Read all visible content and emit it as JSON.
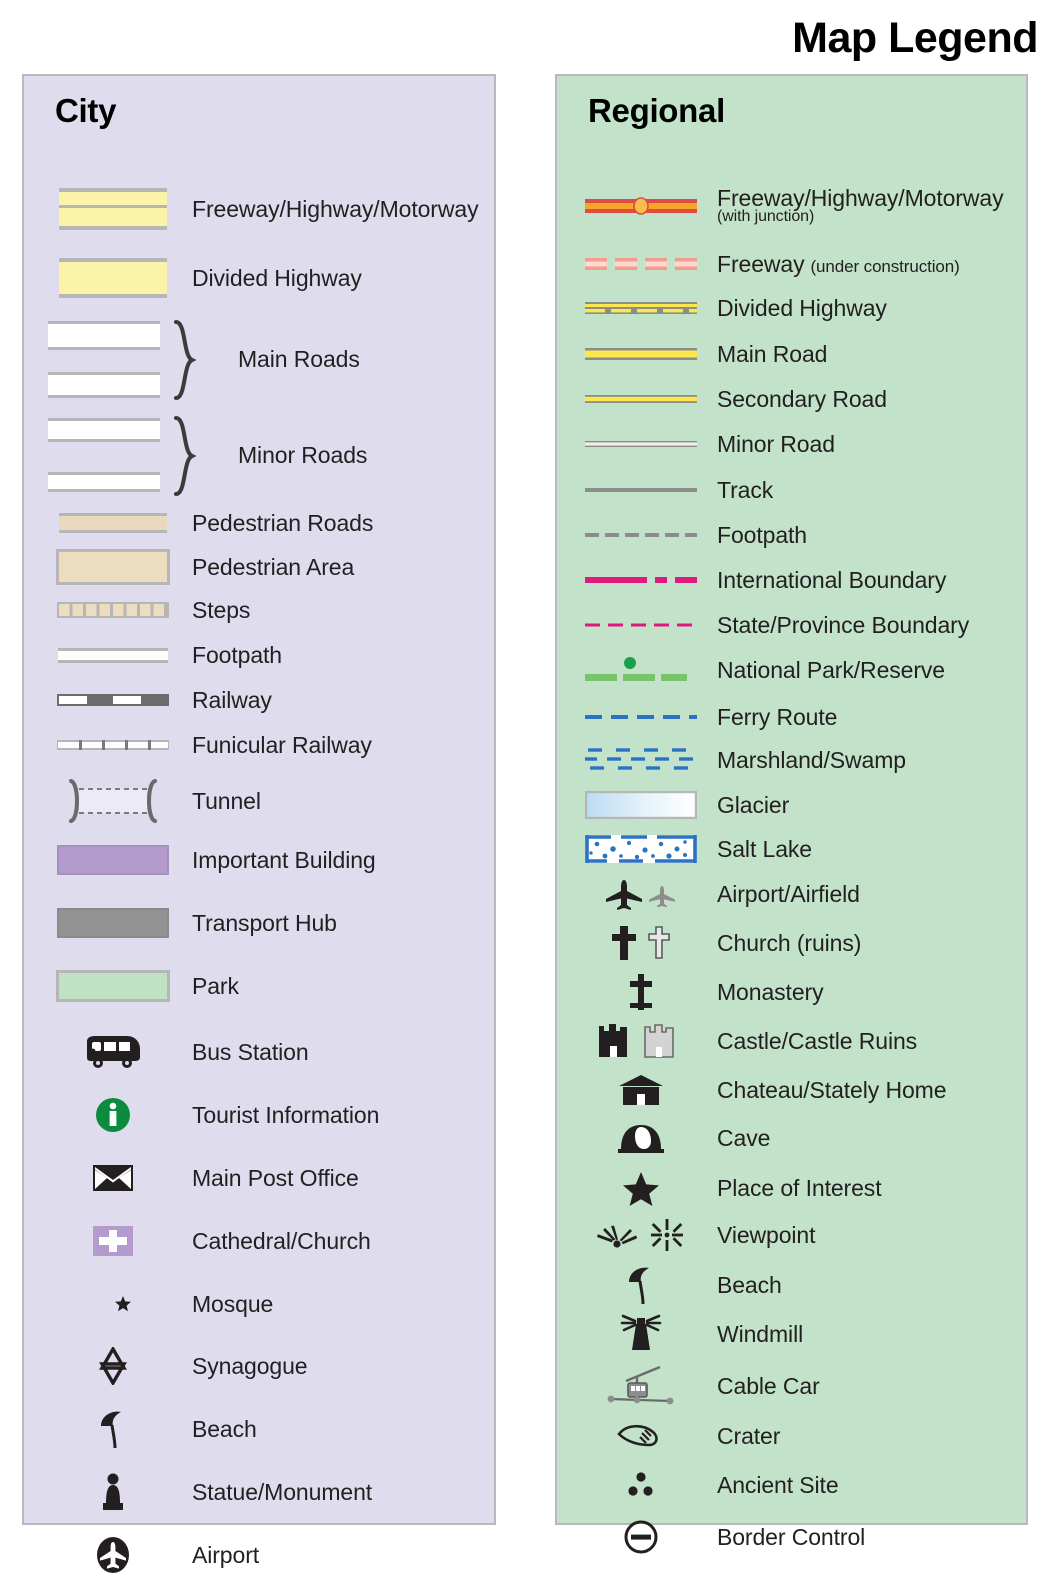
{
  "header": {
    "title": "Map Legend"
  },
  "city": {
    "heading": "City",
    "items": [
      {
        "label": "Freeway/Highway/Motorway",
        "symbol": "freeway-swatch"
      },
      {
        "label": "Divided Highway",
        "symbol": "divided-highway-swatch"
      },
      {
        "label": "Main Roads",
        "symbol": "main-roads-swatch-pair"
      },
      {
        "label": "Minor Roads",
        "symbol": "minor-roads-swatch-pair"
      },
      {
        "label": "Pedestrian Roads",
        "symbol": "pedestrian-road-swatch"
      },
      {
        "label": "Pedestrian Area",
        "symbol": "pedestrian-area-swatch"
      },
      {
        "label": "Steps",
        "symbol": "steps-swatch"
      },
      {
        "label": "Footpath",
        "symbol": "footpath-line"
      },
      {
        "label": "Railway",
        "symbol": "railway-line"
      },
      {
        "label": "Funicular Railway",
        "symbol": "funicular-railway-line"
      },
      {
        "label": "Tunnel",
        "symbol": "tunnel-symbol"
      },
      {
        "label": "Important Building",
        "symbol": "important-building-swatch"
      },
      {
        "label": "Transport Hub",
        "symbol": "transport-hub-swatch"
      },
      {
        "label": "Park",
        "symbol": "park-swatch"
      },
      {
        "label": "Bus Station",
        "symbol": "bus-icon"
      },
      {
        "label": "Tourist Information",
        "symbol": "information-icon"
      },
      {
        "label": "Main Post Office",
        "symbol": "envelope-icon"
      },
      {
        "label": "Cathedral/Church",
        "symbol": "cross-square-icon"
      },
      {
        "label": "Mosque",
        "symbol": "crescent-star-icon"
      },
      {
        "label": "Synagogue",
        "symbol": "star-of-david-icon"
      },
      {
        "label": "Beach",
        "symbol": "parasol-icon"
      },
      {
        "label": "Statue/Monument",
        "symbol": "statue-icon"
      },
      {
        "label": "Airport",
        "symbol": "airport-circle-icon"
      }
    ]
  },
  "regional": {
    "heading": "Regional",
    "items": [
      {
        "label": "Freeway/Highway/Motorway",
        "sub": "(with junction)",
        "symbol": "freeway-junction-line"
      },
      {
        "label": "Freeway",
        "inline_sub": "(under construction)",
        "symbol": "freeway-construction-line"
      },
      {
        "label": "Divided Highway",
        "symbol": "divided-highway-line"
      },
      {
        "label": "Main Road",
        "symbol": "main-road-line"
      },
      {
        "label": "Secondary Road",
        "symbol": "secondary-road-line"
      },
      {
        "label": "Minor Road",
        "symbol": "minor-road-line"
      },
      {
        "label": "Track",
        "symbol": "track-line"
      },
      {
        "label": "Footpath",
        "symbol": "footpath-dashed-line"
      },
      {
        "label": "International Boundary",
        "symbol": "international-boundary-line"
      },
      {
        "label": "State/Province Boundary",
        "symbol": "state-boundary-line"
      },
      {
        "label": "National Park/Reserve",
        "symbol": "national-park-line"
      },
      {
        "label": "Ferry Route",
        "symbol": "ferry-route-line"
      },
      {
        "label": "Marshland/Swamp",
        "symbol": "marshland-pattern"
      },
      {
        "label": "Glacier",
        "symbol": "glacier-swatch"
      },
      {
        "label": "Salt Lake",
        "symbol": "salt-lake-swatch"
      },
      {
        "label": "Airport/Airfield",
        "symbol": "airplane-icon"
      },
      {
        "label": "Church (ruins)",
        "symbol": "church-cross-icon"
      },
      {
        "label": "Monastery",
        "symbol": "monastery-cross-icon"
      },
      {
        "label": "Castle/Castle Ruins",
        "symbol": "castle-icon"
      },
      {
        "label": "Chateau/Stately Home",
        "symbol": "chateau-icon"
      },
      {
        "label": "Cave",
        "symbol": "cave-icon"
      },
      {
        "label": "Place of Interest",
        "symbol": "star-icon"
      },
      {
        "label": "Viewpoint",
        "symbol": "viewpoint-icon"
      },
      {
        "label": "Beach",
        "symbol": "parasol-icon"
      },
      {
        "label": "Windmill",
        "symbol": "windmill-icon"
      },
      {
        "label": "Cable Car",
        "symbol": "cable-car-icon"
      },
      {
        "label": "Crater",
        "symbol": "crater-icon"
      },
      {
        "label": "Ancient Site",
        "symbol": "ancient-site-icon"
      },
      {
        "label": "Border Control",
        "symbol": "border-control-icon"
      }
    ]
  },
  "colors": {
    "city_panel_bg": "#dedced",
    "regional_panel_bg": "#c2e3c9",
    "panel_border": "#b9b9bd",
    "road_yellow": "#fbf3a8",
    "main_road_yellow": "#fbe84f",
    "freeway_red": "#e04a45",
    "freeway_orange": "#f5a623",
    "pedestrian_tan": "#ecdcc0",
    "park_green": "#bfe2c4",
    "important_building_purple": "#b39ccd",
    "transport_hub_grey": "#939393",
    "boundary_magenta": "#e0197f",
    "ferry_blue": "#2c72c4",
    "glacier_blue": "#cfe8f7",
    "national_park_green": "#78c36c",
    "tourist_info_green": "#0c8a3e",
    "icon_dark": "#231f20"
  }
}
